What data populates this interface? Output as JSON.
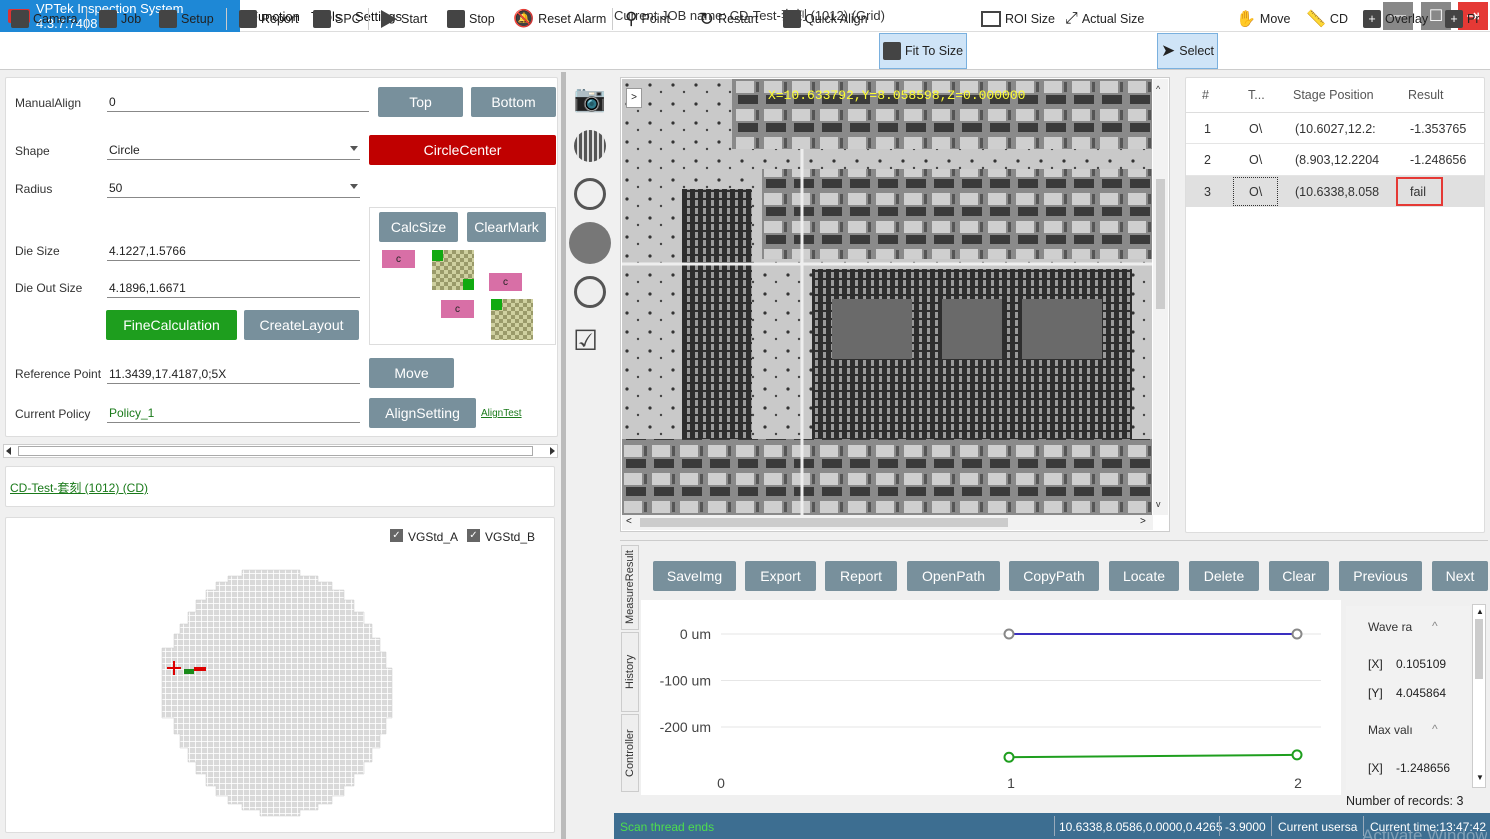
{
  "app": {
    "title": "VPTek Inspection System 4.3.7.7408",
    "logo": "VP",
    "menu": [
      "Function",
      "Tools",
      "Settings"
    ],
    "job": "Current JOB name:  CD-Test-套刻  (1012)   (Grid)"
  },
  "toolbar": [
    "Camera",
    "Job",
    "Setup",
    "Report",
    "SPC",
    "Start",
    "Stop",
    "Reset Alarm",
    "Point",
    "Restart",
    "Quick Align",
    "Fit To Size",
    "ROI Size",
    "Actual Size",
    "Select",
    "Move",
    "CD",
    "Overlay",
    "Pr"
  ],
  "align": {
    "manual_label": "ManualAlign",
    "manual_value": "0",
    "top": "Top",
    "bottom": "Bottom",
    "shape_label": "Shape",
    "shape_value": "Circle",
    "circle_center": "CircleCenter",
    "radius_label": "Radius",
    "radius_value": "50",
    "calc_size": "CalcSize",
    "clear_mark": "ClearMark",
    "mark_c": "c",
    "die_size_label": "Die Size",
    "die_size": "4.1227,1.5766",
    "die_out_label": "Die Out Size",
    "die_out": "4.1896,1.6671",
    "fine": "FineCalculation",
    "create_layout": "CreateLayout",
    "ref_label": "Reference Point",
    "ref_value": "11.3439,17.4187,0;5X",
    "move": "Move",
    "policy_label": "Current Policy",
    "policy_value": "Policy_1",
    "align_setting": "AlignSetting",
    "align_test": "AlignTest"
  },
  "job_link": "CD-Test-套刻  (1012)   (CD)",
  "wafer": {
    "check_a": "VGStd_A",
    "check_b": "VGStd_B"
  },
  "image": {
    "coord": "X=10.633792,Y=8.058598,Z=0.000000",
    "nav": ">"
  },
  "table": {
    "headers": [
      "#",
      "T...",
      "Stage Position",
      "Result"
    ],
    "rows": [
      {
        "n": "1",
        "t": "O\\",
        "pos": "(10.6027,12.2:",
        "res": "-1.353765"
      },
      {
        "n": "2",
        "t": "O\\",
        "pos": "(8.903,12.2204",
        "res": "-1.248656"
      },
      {
        "n": "3",
        "t": "O\\",
        "pos": "(10.6338,8.058",
        "res": "fail"
      }
    ]
  },
  "actions": [
    "SaveImg",
    "Export",
    "Report",
    "OpenPath",
    "CopyPath",
    "Locate",
    "Delete",
    "Clear",
    "Previous",
    "Next"
  ],
  "tabs": [
    "MeasureResult",
    "History",
    "Controller"
  ],
  "chart_data": {
    "type": "line",
    "x": [
      1,
      2
    ],
    "series": [
      {
        "values": [
          0,
          0
        ],
        "color": "#3a2fc0"
      },
      {
        "values": [
          -265,
          -260
        ],
        "color": "#1e9e1e"
      }
    ],
    "yticks": [
      "0 um",
      "-100 um",
      "-200 um"
    ],
    "xticks": [
      "0",
      "1",
      "2"
    ],
    "ylim": [
      -280,
      20
    ],
    "xlim": [
      0,
      2.1
    ]
  },
  "legend": {
    "wave": "Wave ra",
    "wave_x_label": "[X]",
    "wave_x": "0.105109",
    "wave_y_label": "[Y]",
    "wave_y": "4.045864",
    "max": "Max valı",
    "max_x_label": "[X]",
    "max_x": "-1.248656"
  },
  "records": "Number of records: 3",
  "status": {
    "msg": "Scan thread ends",
    "pos": "10.6338,8.0586,0.0000,0.4265",
    "z": "-3.9000",
    "user": "Current usersa",
    "time": "Current time:13:47:42",
    "watermark": "Activate Windows"
  }
}
